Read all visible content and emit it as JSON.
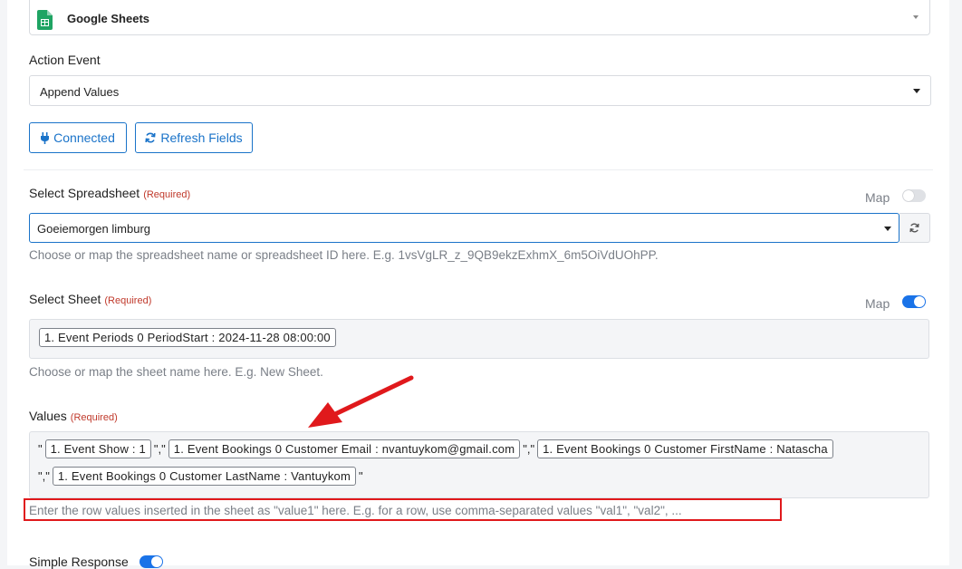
{
  "app": {
    "name": "Google Sheets",
    "icon": "google-sheets-icon"
  },
  "action_event": {
    "label": "Action Event",
    "value": "Append Values"
  },
  "buttons": {
    "connected": "Connected",
    "refresh_fields": "Refresh Fields"
  },
  "spreadsheet": {
    "label": "Select Spreadsheet",
    "required": "(Required)",
    "map_label": "Map",
    "map_enabled": false,
    "value": "Goeiemorgen limburg",
    "help": "Choose or map the spreadsheet name or spreadsheet ID here. E.g. 1vsVgLR_z_9QB9ekzExhmX_6m5OiVdUOhPP."
  },
  "sheet": {
    "label": "Select Sheet",
    "required": "(Required)",
    "map_label": "Map",
    "map_enabled": true,
    "pill": "1. Event Periods 0 PeriodStart : 2024-11-28 08:00:00",
    "help": "Choose or map the sheet name here. E.g. New Sheet."
  },
  "values": {
    "label": "Values",
    "required": "(Required)",
    "quote": "\"",
    "separator": "\",\"",
    "pills": [
      "1. Event Show : 1",
      "1. Event Bookings 0 Customer Email : nvantuykom@gmail.com",
      "1. Event Bookings 0 Customer FirstName : Natascha",
      "1. Event Bookings 0 Customer LastName : Vantuykom"
    ],
    "help": "Enter the row values inserted in the sheet as \"value1\" here. E.g. for a row, use comma-separated values \"val1\", \"val2\", ..."
  },
  "simple_response": {
    "label": "Simple Response",
    "enabled": true
  },
  "colors": {
    "accent": "#1a73e8",
    "annotation": "#e0191c",
    "required": "#c0392b"
  }
}
